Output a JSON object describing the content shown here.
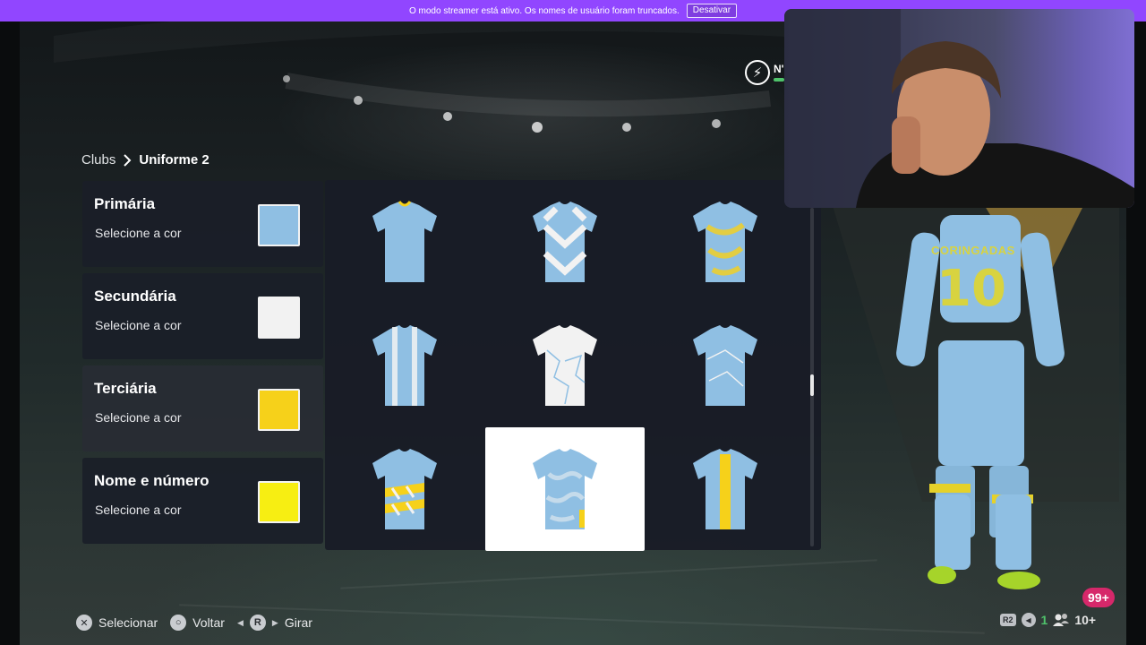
{
  "streamer_banner": {
    "message": "O modo streamer está ativo. Os nomes de usuário foram truncados.",
    "disable_label": "Desativar"
  },
  "breadcrumb": {
    "root": "Clubs",
    "current": "Uniforme 2"
  },
  "color_panels": [
    {
      "title": "Primária",
      "subtitle": "Selecione a cor",
      "swatch": "#8fbfe3"
    },
    {
      "title": "Secundária",
      "subtitle": "Selecione a cor",
      "swatch": "#f2f2f2"
    },
    {
      "title": "Terciária",
      "subtitle": "Selecione a cor",
      "swatch": "#f6d11a"
    },
    {
      "title": "Nome e número",
      "subtitle": "Selecione a cor",
      "swatch": "#f7ee12"
    }
  ],
  "kits": [
    {
      "pattern": "plain",
      "selected": false
    },
    {
      "pattern": "geometric",
      "selected": false
    },
    {
      "pattern": "marble",
      "selected": false
    },
    {
      "pattern": "stripes",
      "selected": false
    },
    {
      "pattern": "crackle",
      "selected": false
    },
    {
      "pattern": "shards",
      "selected": false
    },
    {
      "pattern": "hoops",
      "selected": false
    },
    {
      "pattern": "camo",
      "selected": true
    },
    {
      "pattern": "center-stripe",
      "selected": false
    }
  ],
  "player": {
    "name": "CORINGADAS",
    "number": "10"
  },
  "status": {
    "icon": "lightning-icon",
    "label": "N'"
  },
  "controls": [
    {
      "glyph": "✕",
      "label": "Selecionar"
    },
    {
      "glyph": "○",
      "label": "Voltar"
    },
    {
      "glyph": "R",
      "label": "Girar"
    }
  ],
  "tray": {
    "r2_label": "R2",
    "online_count": "1",
    "friends_count": "10+",
    "notifications": "99+"
  },
  "colors": {
    "kit_primary": "#8fbfe3",
    "kit_secondary": "#f2f2f2",
    "kit_tertiary": "#f6d11a",
    "accent_purple": "#9146ff"
  }
}
